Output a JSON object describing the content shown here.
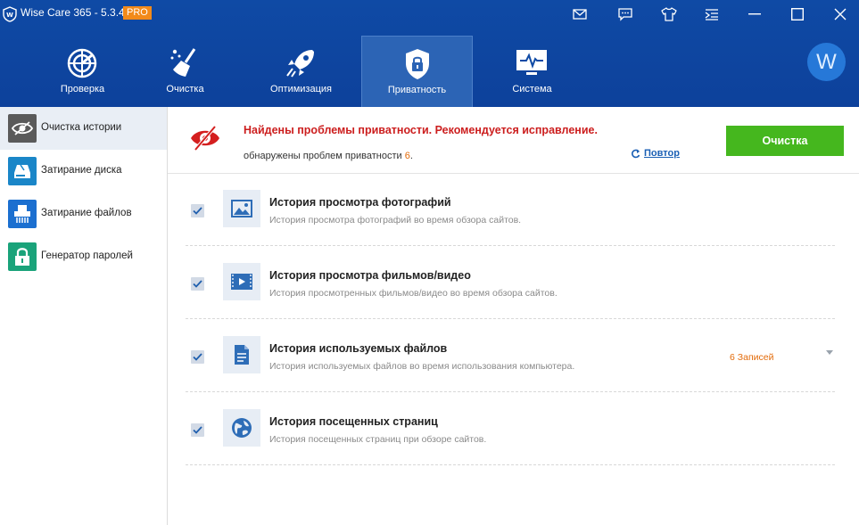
{
  "titlebar": {
    "title": "Wise Care 365 - 5.3.4",
    "badge": "PRO"
  },
  "nav": [
    {
      "label": "Проверка",
      "icon": "radar-icon"
    },
    {
      "label": "Очистка",
      "icon": "broom-icon"
    },
    {
      "label": "Оптимизация",
      "icon": "rocket-icon"
    },
    {
      "label": "Приватность",
      "icon": "privacy-lock-icon"
    },
    {
      "label": "Система",
      "icon": "monitor-icon"
    }
  ],
  "avatar": {
    "letter": "W"
  },
  "sidebar": [
    {
      "label": "Очистка истории",
      "icon": "eye-icon",
      "color": "#555555"
    },
    {
      "label": "Затирание диска",
      "icon": "disk-icon",
      "color": "#1a86c8"
    },
    {
      "label": "Затирание файлов",
      "icon": "shredder-icon",
      "color": "#1b6fd0"
    },
    {
      "label": "Генератор паролей",
      "icon": "lock-icon",
      "color": "#1aa37a"
    }
  ],
  "alert": {
    "title": "Найдены проблемы приватности. Рекомендуется исправление.",
    "sub_prefix": "обнаружены проблем приватности",
    "count": "6",
    "sub_suffix": ".",
    "repeat": "Повтор",
    "clean_button": "Очистка"
  },
  "items": [
    {
      "title": "История просмотра фотографий",
      "desc": "История просмотра фотографий во время обзора сайтов.",
      "icon": "image-icon",
      "count": ""
    },
    {
      "title": "История просмотра фильмов/видео",
      "desc": "История просмотренных фильмов/видео во время обзора сайтов.",
      "icon": "video-icon",
      "count": ""
    },
    {
      "title": "История используемых файлов",
      "desc": "История используемых файлов во время использования компьютера.",
      "icon": "document-icon",
      "count": "6 Записей"
    },
    {
      "title": "История посещенных страниц",
      "desc": "История посещенных страниц при обзоре сайтов.",
      "icon": "globe-icon",
      "count": ""
    }
  ],
  "colors": {
    "header": "#0f4aa5",
    "accent_green": "#45b71e",
    "alert_red": "#cc1e1e",
    "count_orange": "#e36b0a"
  }
}
